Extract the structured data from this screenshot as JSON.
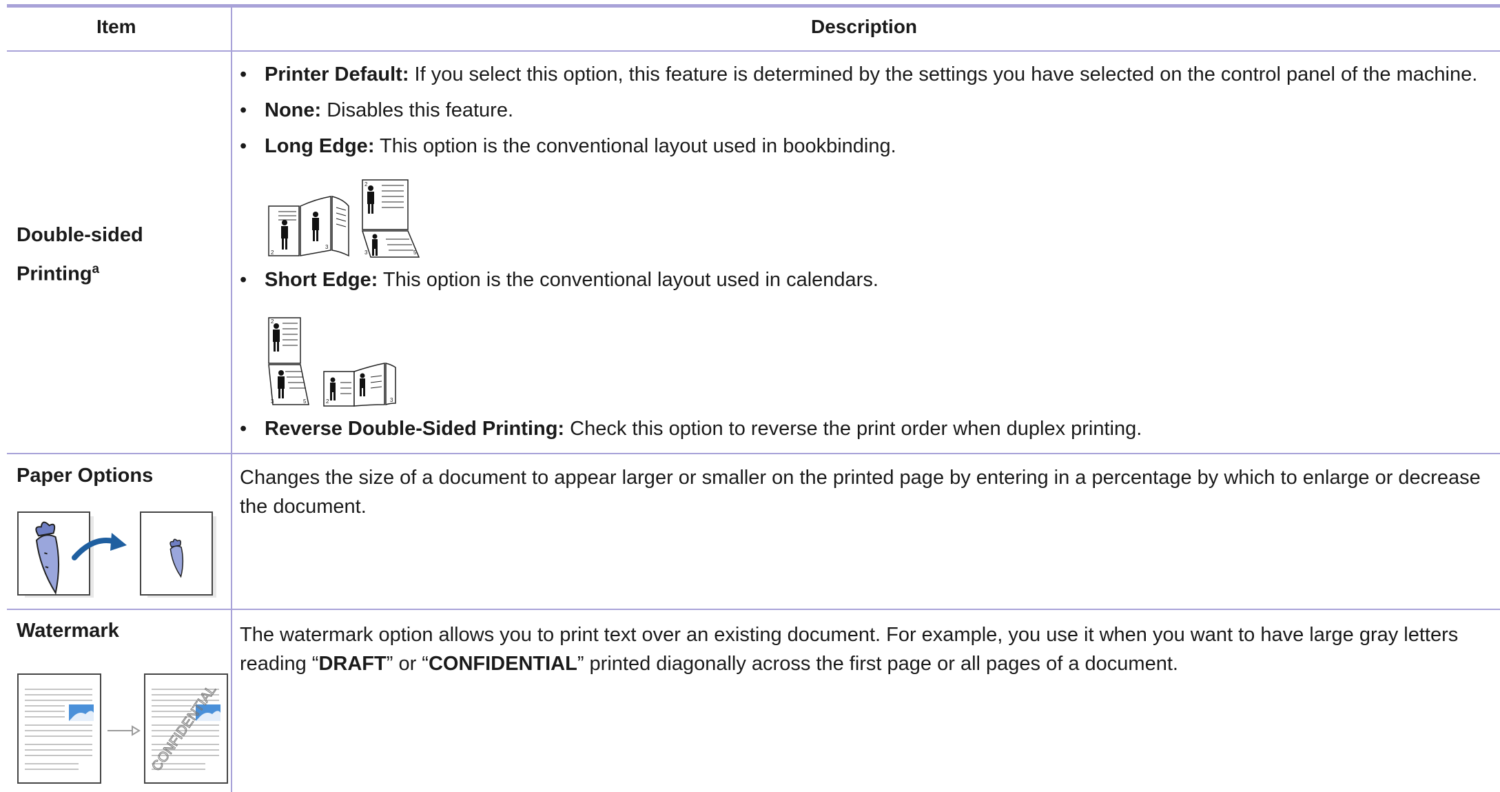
{
  "header": {
    "item": "Item",
    "description": "Description"
  },
  "rows": {
    "duplex": {
      "item": "Double-sided",
      "item_line2": "Printing",
      "item_sup": "a",
      "bullets": [
        {
          "term": "Printer Default:",
          "text": " If you select this option, this feature is determined by the settings you have selected on the control panel of the machine."
        },
        {
          "term": "None:",
          "text": " Disables this feature."
        },
        {
          "term": "Long Edge:",
          "text": " This option is the conventional layout used in bookbinding."
        },
        {
          "term": "Short Edge:",
          "text": " This option is the conventional layout used in calendars."
        },
        {
          "term": "Reverse Double-Sided Printing:",
          "text": " Check this option to reverse the print order when duplex printing."
        }
      ],
      "bullet_char": "•",
      "page_numbers": [
        "2",
        "3",
        "2",
        "3",
        "5",
        "2",
        "3",
        "5",
        "2",
        "3"
      ]
    },
    "paper": {
      "item": "Paper Options",
      "description": "Changes the size of a document to appear larger or smaller on the printed page by entering in a percentage by which to enlarge or decrease the document."
    },
    "watermark": {
      "item": "Watermark",
      "desc_part1": "The watermark option allows you to print text over an existing document. For example, you use it when you want to have large gray letters reading “",
      "desc_bold1": "DRAFT",
      "desc_part2": "” or “",
      "desc_bold2": "CONFIDENTIAL",
      "desc_part3": "” printed diagonally across the first page or all pages of a document.",
      "sample_stamp": "CONFIDENTIAL"
    }
  },
  "colors": {
    "rule": "#a8a2d8",
    "arrow": "#1f5fa0",
    "carrot": "#9aa6dc",
    "sky": "#4a90d9"
  }
}
